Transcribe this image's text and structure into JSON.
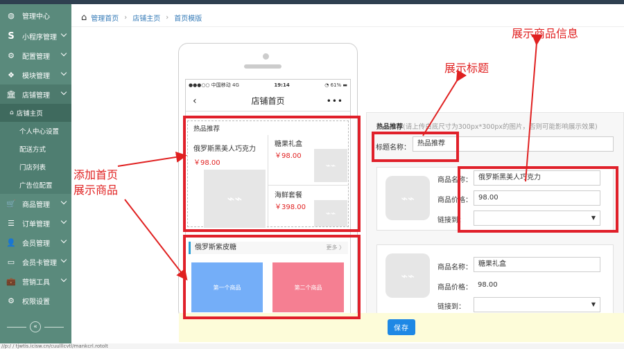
{
  "sidebar": {
    "items": [
      {
        "icon": "dashboard-icon",
        "label": "管理中心"
      },
      {
        "icon": "s-icon",
        "label": "小程序管理"
      },
      {
        "icon": "cogs-icon",
        "label": "配置管理"
      },
      {
        "icon": "cubes-icon",
        "label": "模块管理"
      },
      {
        "icon": "bank-icon",
        "label": "店铺管理"
      }
    ],
    "subitems": [
      "店铺主页",
      "个人中心设置",
      "配送方式",
      "门店列表",
      "广告位配置"
    ],
    "items2": [
      {
        "icon": "cart-icon",
        "label": "商品管理"
      },
      {
        "icon": "list-icon",
        "label": "订单管理"
      },
      {
        "icon": "user-icon",
        "label": "会员管理"
      },
      {
        "icon": "card-icon",
        "label": "会员卡管理"
      },
      {
        "icon": "briefcase-icon",
        "label": "营销工具"
      },
      {
        "icon": "gear-icon",
        "label": "权限设置"
      }
    ],
    "collapse_glyph": "«"
  },
  "breadcrumb": [
    "管理首页",
    "店铺主页",
    "首页模版"
  ],
  "phone": {
    "carrier": "●●●○○ 中国移动  4G",
    "time": "19:14",
    "battery": "◔ 61% ▬",
    "title": "店铺首页",
    "back": "‹",
    "more": "•••",
    "hot_title": "热品推荐",
    "products": [
      {
        "name": "俄罗斯黑美人巧克力",
        "price": "￥98.00"
      },
      {
        "name": "糖果礼盒",
        "price": "￥98.00"
      },
      {
        "name": "海鲜套餐",
        "price": "￥398.00"
      }
    ],
    "category_title": "俄罗斯紫皮糖",
    "category_more": "更多 〉",
    "tiles": [
      "第一个商品",
      "第二个商品"
    ]
  },
  "panel": {
    "hint_bold": "热品推荐",
    "hint": "(请上传白底尺寸为300px*300px的图片，否则可能影响展示效果)",
    "title_label": "标题名称：",
    "title_value": "热品推荐",
    "cards": [
      {
        "name_label": "商品名称：",
        "name": "俄罗斯黑美人巧克力",
        "price_label": "商品价格：",
        "price": "98.00",
        "link_label": "链接到："
      },
      {
        "name_label": "商品名称：",
        "name": "糖果礼盒",
        "price_label": "商品价格：",
        "price": "98.00",
        "link_label": "链接到："
      }
    ],
    "select_arrow": "▼"
  },
  "save_label": "保存",
  "annotations": {
    "show_product_info": "展示商品信息",
    "show_title": "展示标题",
    "add_home_1": "添加首页",
    "add_home_2": "展示商品"
  },
  "placeholder_glyph": "⌁⌁",
  "status_url": "//p:/ / tjwtis.icisw.cn/cuulllcvtl/mankcrl.rotolt",
  "colors": {
    "sidebar": "#5a8a7c",
    "accent": "#1e88e5",
    "annotation": "#e02020",
    "price": "#e02020"
  }
}
